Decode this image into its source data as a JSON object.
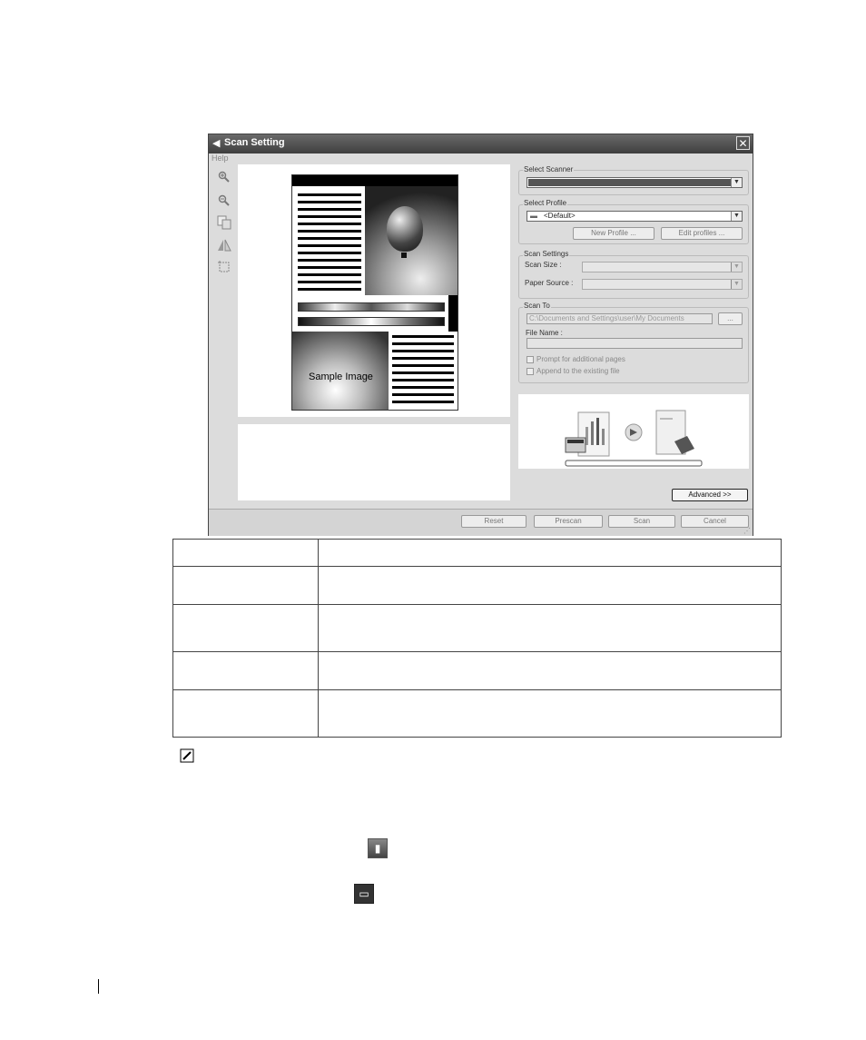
{
  "window": {
    "title": "Scan Setting",
    "close_glyph": "✕"
  },
  "menu": {
    "help": "Help"
  },
  "preview": {
    "sample_text": "Sample Image"
  },
  "scanner": {
    "group_label": "Select Scanner"
  },
  "profile": {
    "group_label": "Select Profile",
    "selected": "<Default>",
    "new_profile_label": "New Profile ...",
    "edit_profiles_label": "Edit profiles ..."
  },
  "scan_settings": {
    "group_label": "Scan Settings",
    "scan_size_label": "Scan Size :",
    "paper_source_label": "Paper Source :"
  },
  "scan_to": {
    "group_label": "Scan To",
    "path": "C:\\Documents and Settings\\user\\My Documents",
    "browse_label": "...",
    "file_name_label": "File Name :",
    "prompt_label": "Prompt for additional pages",
    "append_label": "Append to the existing file"
  },
  "advanced_label": "Advanced >>",
  "buttons": {
    "reset": "Reset",
    "prescan": "Prescan",
    "scan": "Scan",
    "cancel": "Cancel"
  },
  "icons": {
    "zoom_in": "zoom-in-icon",
    "zoom_out": "zoom-out-icon",
    "fit": "fit-page-icon",
    "flip": "flip-icon",
    "crop": "crop-icon",
    "note": "pencil-note-icon",
    "scanner_app": "scanner-app-icon",
    "printer": "printer-icon"
  }
}
